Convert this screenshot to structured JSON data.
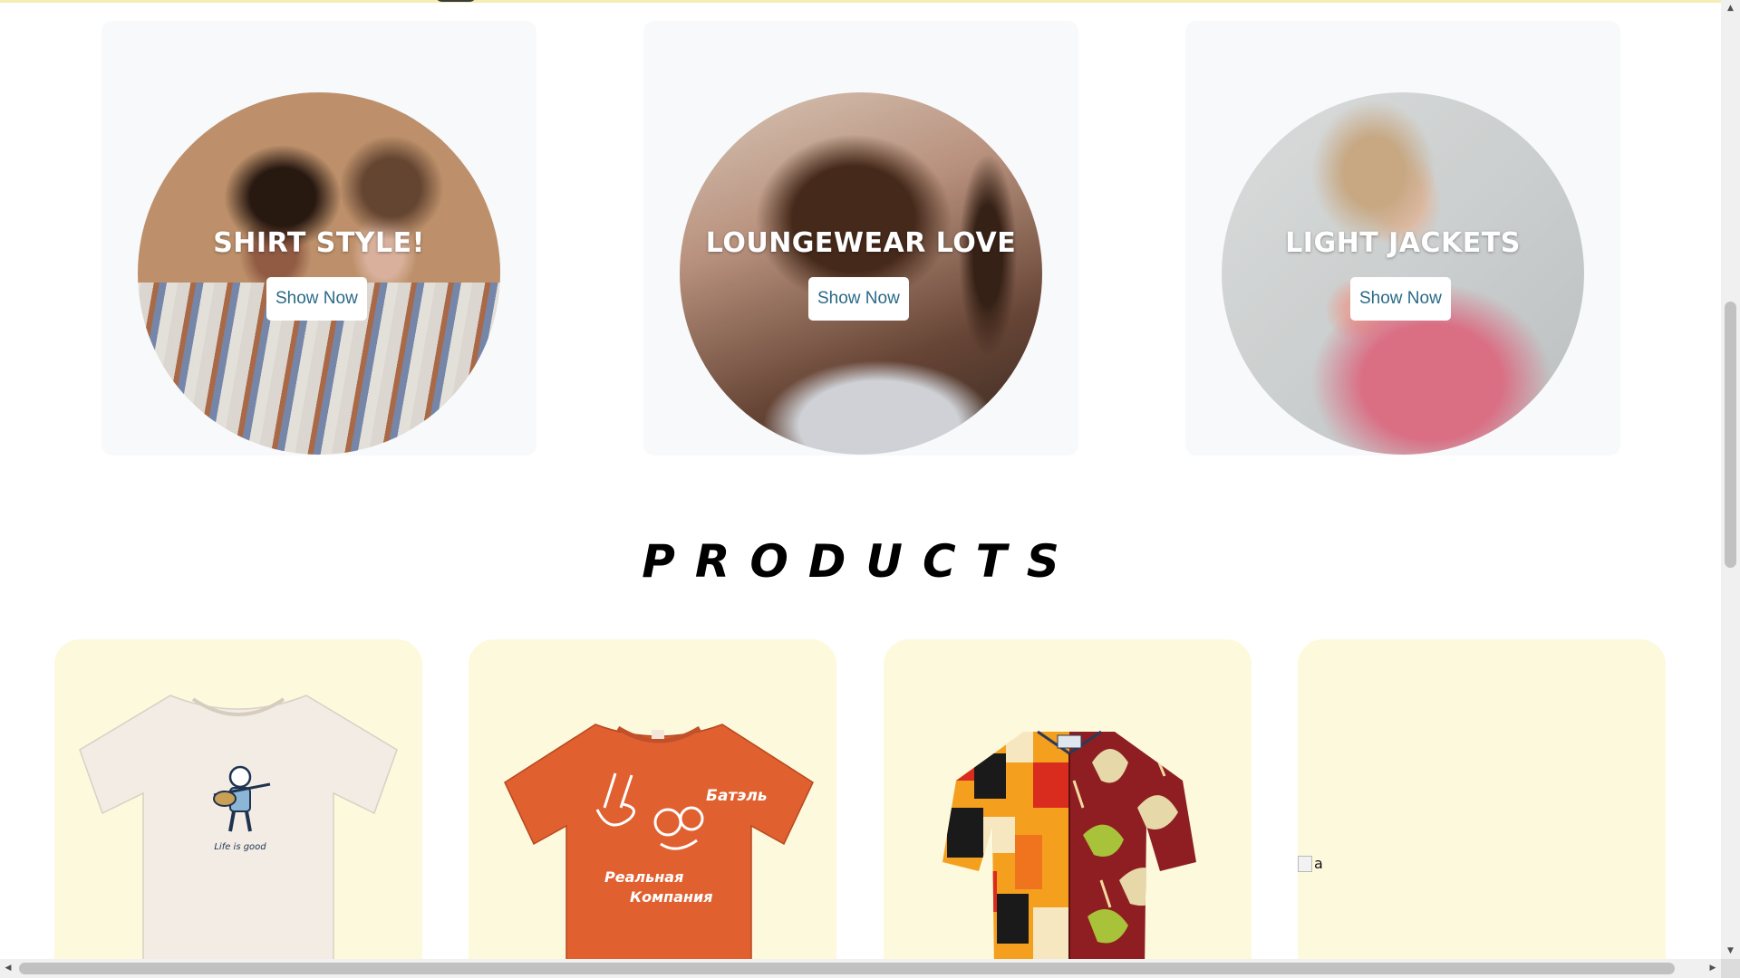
{
  "categories": [
    {
      "title": "SHIRT STYLE!",
      "button": "Show Now"
    },
    {
      "title": "LOUNGEWEAR LOVE",
      "button": "Show Now"
    },
    {
      "title": "LIGHT JACKETS",
      "button": "Show Now"
    }
  ],
  "products_heading": "PRODUCTS",
  "products": [
    {
      "image_alt": "cream t-shirt",
      "print_text": "Life is good"
    },
    {
      "image_alt": "orange t-shirt",
      "print_line1": "Батэль",
      "print_line2": "Реальная",
      "print_line3": "Компания"
    },
    {
      "image_alt": "patterned shirt"
    },
    {
      "image_alt": "a"
    }
  ],
  "colors": {
    "card_bg": "#f8f9fb",
    "product_bg": "#fdf9dd",
    "button_text": "#2b6a88",
    "top_line": "#f4eeb4"
  },
  "icons": {
    "scroll_up": "triangle-up",
    "scroll_down": "triangle-down",
    "scroll_left": "triangle-left",
    "scroll_right": "triangle-right"
  }
}
